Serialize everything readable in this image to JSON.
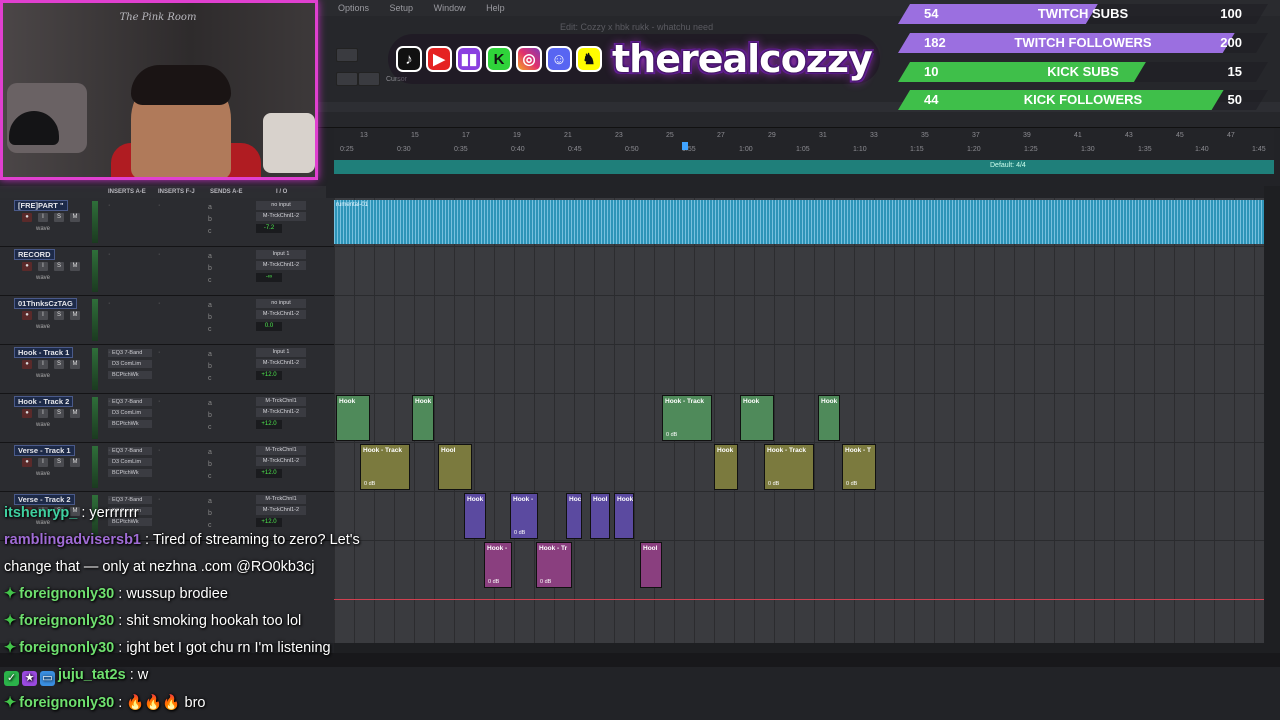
{
  "menu": {
    "items": [
      "Options",
      "Setup",
      "Window",
      "Help"
    ]
  },
  "daw": {
    "title": "Edit: Cozzy x hbk rukk - whatchu need",
    "cursor_label": "Cursor",
    "timeline": {
      "bars": [
        "13",
        "15",
        "17",
        "19",
        "21",
        "23",
        "25",
        "27",
        "29",
        "31",
        "33",
        "35",
        "37",
        "39",
        "41",
        "43",
        "45",
        "47"
      ],
      "times": [
        "0:25",
        "0:30",
        "0:35",
        "0:40",
        "0:45",
        "0:50",
        "0:55",
        "1:00",
        "1:05",
        "1:10",
        "1:15",
        "1:20",
        "1:25",
        "1:30",
        "1:35",
        "1:40",
        "1:45"
      ],
      "meter_label": "Default: 4/4"
    },
    "mixer_headers": [
      "INSERTS A-E",
      "INSERTS F-J",
      "SENDS A-E",
      "I / O"
    ],
    "tracks": [
      {
        "name": "[FRE]PART \"",
        "input": "no input",
        "output": "M-TrckChnl1-2",
        "volume": "-7.2",
        "inserts": []
      },
      {
        "name": "RECORD",
        "input": "Input 1",
        "output": "M-TrckChnl1-2",
        "volume": "-∞",
        "inserts": []
      },
      {
        "name": "01ThnksCzTAG",
        "input": "no input",
        "output": "M-TrckChnl1-2",
        "volume": "0.0",
        "inserts": []
      },
      {
        "name": "Hook - Track 1",
        "input": "Input 1",
        "output": "M-TrckChnl1-2",
        "volume": "+12.0",
        "inserts": [
          "EQ3 7-Band",
          "D3 ComLim",
          "BCPtchWk"
        ]
      },
      {
        "name": "Hook - Track 2",
        "input": "M-TrckChnl1",
        "output": "M-TrckChnl1-2",
        "volume": "+12.0",
        "inserts": [
          "EQ3 7-Band",
          "D3 ComLim",
          "BCPtchWk"
        ]
      },
      {
        "name": "Verse - Track 1",
        "input": "M-TrckChnl1",
        "output": "M-TrckChnl1-2",
        "volume": "+12.0",
        "inserts": [
          "EQ3 7-Band",
          "D3 ComLim",
          "BCPtchWk"
        ]
      },
      {
        "name": "Verse - Track 2",
        "input": "M-TrckChnl1",
        "output": "M-TrckChnl1-2",
        "volume": "+12.0",
        "inserts": [
          "EQ3 7-Band",
          "D3 ComLim",
          "BCPtchWk"
        ]
      }
    ],
    "track_view": "wave",
    "audio_clip_name": "rumental-01",
    "clips": [
      {
        "label": "Hook",
        "gain": "",
        "color": "green"
      },
      {
        "label": "Hook",
        "gain": "",
        "color": "green"
      },
      {
        "label": "Hook - Track",
        "gain": "0 dB",
        "color": "green"
      },
      {
        "label": "Hook",
        "gain": "",
        "color": "green"
      },
      {
        "label": "Hook",
        "gain": "",
        "color": "green"
      },
      {
        "label": "Hook - Track",
        "gain": "0 dB",
        "color": "olive"
      },
      {
        "label": "Hool",
        "gain": "",
        "color": "olive"
      },
      {
        "label": "Hook",
        "gain": "",
        "color": "olive"
      },
      {
        "label": "Hook - Track",
        "gain": "0 dB",
        "color": "olive"
      },
      {
        "label": "Hook - T",
        "gain": "0 dB",
        "color": "olive"
      },
      {
        "label": "Hook",
        "gain": "",
        "color": "purple"
      },
      {
        "label": "Hook -",
        "gain": "0 dB",
        "color": "purple"
      },
      {
        "label": "Hoc",
        "gain": "",
        "color": "purple"
      },
      {
        "label": "Hool",
        "gain": "",
        "color": "purple"
      },
      {
        "label": "Hook",
        "gain": "",
        "color": "purple"
      },
      {
        "label": "Hook -",
        "gain": "0 dB",
        "color": "magenta"
      },
      {
        "label": "Hook - Tr",
        "gain": "0 dB",
        "color": "magenta"
      },
      {
        "label": "Hool",
        "gain": "",
        "color": "magenta"
      }
    ]
  },
  "overlay": {
    "social_handle": "therealcozzy",
    "social_icons": [
      "tiktok-icon",
      "youtube-icon",
      "twitch-icon",
      "kick-icon",
      "instagram-icon",
      "discord-icon",
      "snapchat-icon"
    ],
    "goals": [
      {
        "label": "TWITCH SUBS",
        "current": "54",
        "target": "100",
        "progress": 0.54,
        "color": "#9b6fe0"
      },
      {
        "label": "TWITCH FOLLOWERS",
        "current": "182",
        "target": "200",
        "progress": 0.91,
        "color": "#9b6fe0"
      },
      {
        "label": "KICK SUBS",
        "current": "10",
        "target": "15",
        "progress": 0.67,
        "color": "#3fbf4a"
      },
      {
        "label": "KICK FOLLOWERS",
        "current": "44",
        "target": "50",
        "progress": 0.88,
        "color": "#3fbf4a"
      }
    ],
    "webcam_sign": "The Pink Room"
  },
  "chat": [
    {
      "user": "itshenryp_",
      "user_color": "#3fd0a0",
      "badges": [],
      "message": " : yerrrrrrr"
    },
    {
      "user": "ramblingadvisersb1",
      "user_color": "#a06cd5",
      "badges": [],
      "message": " : Tired of streaming to zero? Let's"
    },
    {
      "user": "",
      "user_color": "#ffffff",
      "badges": [],
      "message": "change that — only at nezhna .com @RO0kb3cj"
    },
    {
      "user": "foreignonly30",
      "user_color": "#6fe06f",
      "badges": [
        "sword"
      ],
      "message": " : wussup brodiee"
    },
    {
      "user": "foreignonly30",
      "user_color": "#6fe06f",
      "badges": [
        "sword"
      ],
      "message": " : shit smoking hookah too lol"
    },
    {
      "user": "foreignonly30",
      "user_color": "#6fe06f",
      "badges": [
        "sword"
      ],
      "message": " : ight bet I got chu rn I'm listening"
    },
    {
      "user": "juju_tat2s",
      "user_color": "#6fe06f",
      "badges": [
        "check",
        "star",
        "tv"
      ],
      "message": " : w"
    },
    {
      "user": "foreignonly30",
      "user_color": "#6fe06f",
      "badges": [
        "sword"
      ],
      "message": " : 🔥🔥🔥 bro"
    }
  ]
}
